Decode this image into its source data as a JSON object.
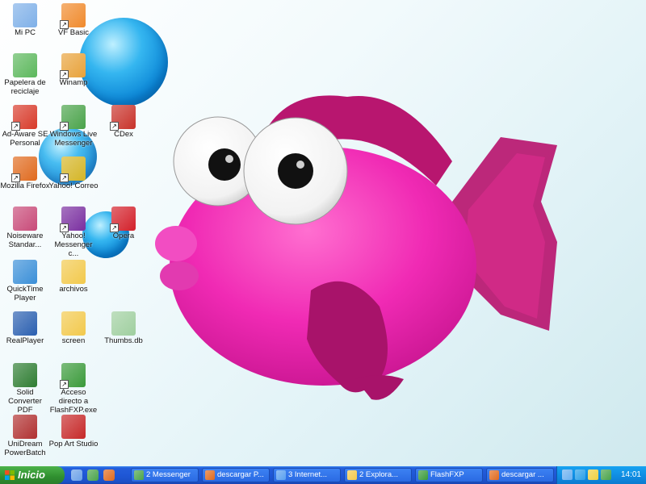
{
  "desktop": {
    "icons": [
      {
        "label": "Mi PC",
        "icon": "my-computer-icon",
        "color": "#7fb0e8",
        "shortcut": false
      },
      {
        "label": "VF Basic",
        "icon": "vf-basic-icon",
        "color": "#f08a2c",
        "shortcut": true
      },
      {
        "label": "Papelera de reciclaje",
        "icon": "recycle-bin-icon",
        "color": "#5cb85c",
        "shortcut": false
      },
      {
        "label": "Winamp",
        "icon": "winamp-icon",
        "color": "#e8a23a",
        "shortcut": true
      },
      {
        "label": "Ad-Aware SE Personal",
        "icon": "ad-aware-icon",
        "color": "#d83a2a",
        "shortcut": true
      },
      {
        "label": "Windows Live Messenger",
        "icon": "messenger-icon",
        "color": "#4aa34a",
        "shortcut": true
      },
      {
        "label": "CDex",
        "icon": "cdex-icon",
        "color": "#c8322a",
        "shortcut": true
      },
      {
        "label": "Mozilla Firefox",
        "icon": "firefox-icon",
        "color": "#e06a1e",
        "shortcut": true
      },
      {
        "label": "Yahoo! Correo",
        "icon": "yahoo-mail-icon",
        "color": "#d4b526",
        "shortcut": true
      },
      {
        "label": "Noiseware Standar...",
        "icon": "noiseware-icon",
        "color": "#c84a78",
        "shortcut": false
      },
      {
        "label": "Yahoo! Messenger c...",
        "icon": "yahoo-messenger-icon",
        "color": "#7a2fa0",
        "shortcut": true
      },
      {
        "label": "Opera",
        "icon": "opera-icon",
        "color": "#d3202a",
        "shortcut": true
      },
      {
        "label": "QuickTime Player",
        "icon": "quicktime-icon",
        "color": "#3a8fd8",
        "shortcut": false
      },
      {
        "label": "archivos",
        "icon": "folder-icon",
        "color": "#f2c94c",
        "shortcut": false
      },
      {
        "label": "RealPlayer",
        "icon": "realplayer-icon",
        "color": "#2a5fb0",
        "shortcut": false
      },
      {
        "label": "screen",
        "icon": "folder-icon",
        "color": "#f2c94c",
        "shortcut": false
      },
      {
        "label": "Thumbs.db",
        "icon": "file-icon",
        "color": "#9fcf9f",
        "shortcut": false
      },
      {
        "label": "Solid Converter PDF",
        "icon": "solid-converter-icon",
        "color": "#2e7d32",
        "shortcut": false
      },
      {
        "label": "Acceso directo a FlashFXP.exe",
        "icon": "flashfxp-icon",
        "color": "#3a9a3a",
        "shortcut": true
      },
      {
        "label": "UniDream PowerBatch",
        "icon": "unidream-icon",
        "color": "#b03030",
        "shortcut": false
      },
      {
        "label": "Pop Art Studio",
        "icon": "pop-art-icon",
        "color": "#c62828",
        "shortcut": false
      }
    ]
  },
  "taskbar": {
    "start_label": "Inicio",
    "quick_launch": [
      {
        "icon": "show-desktop-icon",
        "color": "#6aa0e8"
      },
      {
        "icon": "messenger-icon",
        "color": "#4aa34a"
      },
      {
        "icon": "firefox-icon",
        "color": "#e06a1e"
      }
    ],
    "tasks": [
      {
        "label": "2 Messenger",
        "icon": "messenger-icon",
        "color": "#4aa34a"
      },
      {
        "label": "descargar P...",
        "icon": "firefox-icon",
        "color": "#e06a1e"
      },
      {
        "label": "3 Internet...",
        "icon": "ie-icon",
        "color": "#5aa0f0"
      },
      {
        "label": "2 Explora...",
        "icon": "folder-icon",
        "color": "#f2c94c"
      },
      {
        "label": "FlashFXP",
        "icon": "flashfxp-icon",
        "color": "#3a9a3a"
      },
      {
        "label": "descargar ...",
        "icon": "firefox-icon",
        "color": "#e06a1e"
      }
    ],
    "tray": {
      "icons": [
        {
          "icon": "network-icon",
          "color": "#6ab0f0"
        },
        {
          "icon": "skype-icon",
          "color": "#2aa0e8"
        },
        {
          "icon": "language-icon",
          "color": "#f0d040"
        },
        {
          "icon": "messenger-tray-icon",
          "color": "#4aa34a"
        }
      ],
      "clock": "14:01"
    }
  }
}
